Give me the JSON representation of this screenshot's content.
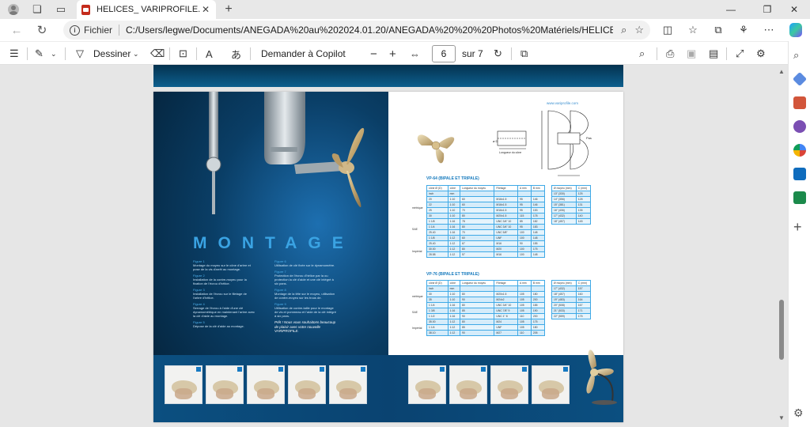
{
  "browser": {
    "tab_title": "HELICES_ VARIPROFILE.pdf",
    "tab_close": "✕",
    "new_tab": "+",
    "window_controls": [
      "—",
      "❐",
      "✕"
    ]
  },
  "address": {
    "scheme": "Fichier",
    "url": "C:/Users/legwe/Documents/ANEGADA%20au%202024.01.20/ANEGADA%20%20%20Photos%20Matériels/HELICES%20VARIPROF..."
  },
  "pdf_toolbar": {
    "draw_label": "Dessiner",
    "copilot_label": "Demander à Copilot",
    "page_current": "6",
    "page_total": "sur 7",
    "read_aloud": "A",
    "translate": "あ"
  },
  "brochure": {
    "left": {
      "heading": "MONTAGE",
      "col1": [
        {
          "t": "Figure 1",
          "d": "Montage du moyeu sur le cône d'arbre et pose de la vis d'arrêt au montage."
        },
        {
          "t": "Figure 2",
          "d": "Installation de la contre-moyeu pour la fixation de l'écrou d'hélice."
        },
        {
          "t": "Figure 3",
          "d": "Installation de l'écrou sur le filetage de l'arbre d'hélice."
        },
        {
          "t": "Figure 4",
          "d": "Serrage de l'écrou à l'aide d'une clé dynamométrique en maintenant l'arbre avec la clé d'aide au montage."
        },
        {
          "t": "Figure 5",
          "d": "Dépose de la clé d'aide au montage."
        }
      ],
      "col2": [
        {
          "t": "Figure 6",
          "d": "Utilisation de clé fixée sur le dynamomètre."
        },
        {
          "t": "Figure 7",
          "d": "Protection de l'écrou d'hélice par la ou protection la clé d'aide et une clé intégré à six pans."
        },
        {
          "t": "Figure 8",
          "d": "Montage de la tête sur le moyeu, utilisation de contre-moyeu sur les trous de."
        },
        {
          "t": "Figure 9",
          "d": "Utilisation de contre-taille pour le montage de vis et pommeau et l'aide de la clé intégré à six pans."
        }
      ],
      "slogan": "Prêt ! Nous vous souhaitons beaucoup de plaisir avec votre nouvelle VARIPROFILE."
    },
    "right": {
      "website": "www.variprofile.com",
      "dim_phi": "ø D",
      "dim_length": "Longueur du cône",
      "dim_pitch": "Pas",
      "table1_title": "VP-64 (BIPALE ET TRIPALE)",
      "table1_head": [
        "cône Ø (D)",
        "cône",
        "Longueur du moyeu",
        "Filetage",
        "A mm",
        "B mm"
      ],
      "table1_rows": [
        [
          "inch",
          "mm",
          "",
          "",
          "",
          ""
        ],
        [
          "20",
          "1:10",
          "60",
          "M16x1.5",
          "95",
          "146"
        ],
        [
          "22",
          "1:10",
          "60",
          "M16x1.5",
          "95",
          "146"
        ],
        [
          "25",
          "1:10",
          "70",
          "M16x1.5",
          "95",
          "153"
        ],
        [
          "30",
          "1:10",
          "80",
          "M20x1.5",
          "115",
          "178"
        ],
        [
          "1 1/8",
          "1:16",
          "78",
          "UNC 3/4\" 10",
          "85",
          "182"
        ],
        [
          "1 1/4",
          "1:16",
          "80",
          "UNC 3/4\" 10",
          "95",
          "183"
        ],
        [
          "25.40",
          "1:16",
          "70",
          "UNC 5/8\"",
          "100",
          "148"
        ],
        [
          "1 1/8",
          "1:12",
          "60",
          "UNF",
          "100",
          "148"
        ],
        [
          "25.40",
          "1:12",
          "67",
          "M16",
          "90",
          "155"
        ],
        [
          "30.00",
          "1:12",
          "80",
          "M20",
          "100",
          "175"
        ],
        [
          "28.58",
          "1:12",
          "57",
          "M16",
          "100",
          "148"
        ]
      ],
      "table1_row_labels": [
        "métrique",
        "SAE",
        "Impérial"
      ],
      "table1_side_head": [
        "Ø moyeu (mm)",
        "C (mm)"
      ],
      "table1_side_rows": [
        [
          "13\" (330)",
          "125"
        ],
        [
          "14\" (356)",
          "128"
        ],
        [
          "15\" (381)",
          "131"
        ],
        [
          "16\" (406)",
          "135"
        ],
        [
          "17\" (432)",
          "140"
        ],
        [
          "18\" (457)",
          "145"
        ]
      ],
      "table2_title": "VP-76 (BIPALE ET TRIPALE)",
      "table2_head": [
        "cône Ø (D)",
        "cône",
        "Longueur du moyeu",
        "Filetage",
        "A mm",
        "B mm"
      ],
      "table2_rows": [
        [
          "inch",
          "mm",
          "",
          "",
          "",
          ""
        ],
        [
          "30",
          "1:10",
          "80",
          "M20x1.5",
          "105",
          "180"
        ],
        [
          "35",
          "1:10",
          "90",
          "M24x2",
          "105",
          "200"
        ],
        [
          "1 1/4",
          "1:16",
          "80",
          "UNC 3/4\" 10",
          "105",
          "185"
        ],
        [
          "1 3/8",
          "1:16",
          "85",
          "UNC 7/8\" 9",
          "105",
          "190"
        ],
        [
          "1 1/2",
          "1:16",
          "90",
          "UNC 1\" 8",
          "110",
          "200"
        ],
        [
          "35.00",
          "1:12",
          "80",
          "M24",
          "105",
          "175"
        ],
        [
          "1 1/4",
          "1:12",
          "85",
          "UNF",
          "105",
          "180"
        ],
        [
          "38.10",
          "1:12",
          "90",
          "M27",
          "110",
          "205"
        ]
      ],
      "table2_row_labels": [
        "métrique",
        "SAE",
        "Impérial"
      ],
      "table2_side_head": [
        "Ø moyeu (mm)",
        "C (mm)"
      ],
      "table2_side_rows": [
        [
          "17\" (432)",
          "157"
        ],
        [
          "18\" (457)",
          "160"
        ],
        [
          "19\" (483)",
          "164"
        ],
        [
          "20\" (508)",
          "167"
        ],
        [
          "21\" (533)",
          "171"
        ],
        [
          "22\" (559)",
          "175"
        ]
      ]
    }
  },
  "colors": {
    "brand_blue": "#1479bd",
    "heading_blue": "#3aa3e3",
    "dark_blue": "#031e33"
  }
}
